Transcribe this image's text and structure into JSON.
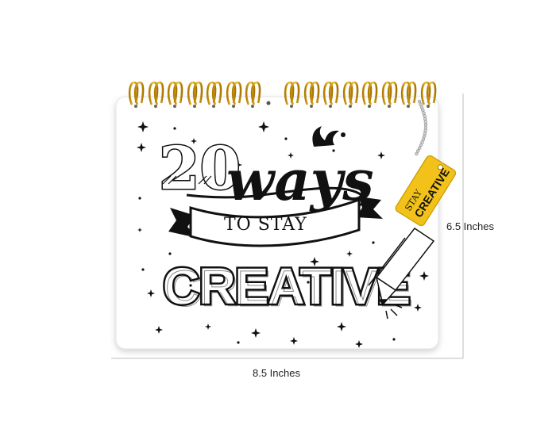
{
  "product": {
    "cover": {
      "number": "20",
      "word_ways": "ways",
      "ribbon_text": "TO STAY",
      "word_creative": "CREATIVE"
    },
    "tag": {
      "line1": "STAY",
      "line2": "CREATIVE"
    }
  },
  "dimensions": {
    "width_label": "8.5 Inches",
    "height_label": "6.5 Inches"
  },
  "colors": {
    "background": "#ffffff",
    "cover": "#ffffff",
    "ink": "#111111",
    "binding": "#e3a400",
    "tag": "#f2c21a",
    "dimension_line": "#bdbdbd"
  }
}
